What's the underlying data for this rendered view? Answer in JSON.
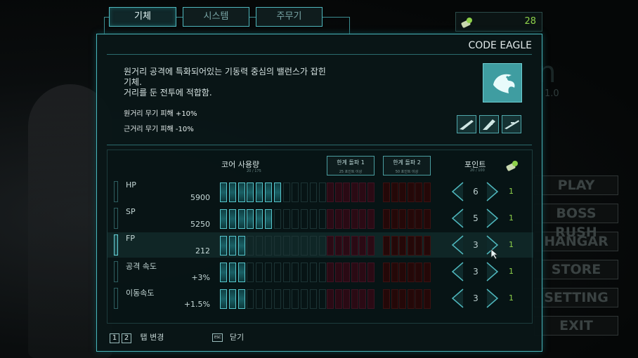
{
  "tabs": [
    {
      "label": "기체",
      "active": true
    },
    {
      "label": "시스템",
      "active": false
    },
    {
      "label": "주무기",
      "active": false
    }
  ],
  "credits": {
    "value": "28",
    "icon": "credit-chip-icon",
    "color": "#8ed14a"
  },
  "background": {
    "menu": [
      "PLAY",
      "BOSS RUSH",
      "HANGAR",
      "STORE",
      "SETTING",
      "EXIT"
    ],
    "version": "1.0"
  },
  "mech": {
    "name": "CODE EAGLE",
    "description_lines": [
      "원거리 공격에 특화되어있는 기동력 중심의 밸런스가  잡힌",
      "기체.",
      "거리를 둔 전투에 적합함."
    ],
    "modifiers": [
      "원거리 무기 피해 +10%",
      "근거리 무기 피해 -10%"
    ],
    "emblem_icon": "eagle-emblem-icon",
    "weapons": [
      "rifle-icon",
      "launcher-icon",
      "sniper-icon"
    ]
  },
  "stats_header": {
    "core_usage_label": "코어 사용량",
    "core_usage_value": "20 / 175",
    "limit1": {
      "title": "한계 돌파 1",
      "sub": "25 포인트 이상"
    },
    "limit2": {
      "title": "한계 돌파 2",
      "sub": "50 포인트 이상"
    },
    "points_label": "포인트",
    "points_value": "20 / 100"
  },
  "stats": [
    {
      "name": "HP",
      "value": "5900",
      "bars_on": 7,
      "points": "6",
      "cost": "1",
      "selected": false
    },
    {
      "name": "SP",
      "value": "5250",
      "bars_on": 6,
      "points": "5",
      "cost": "1",
      "selected": false
    },
    {
      "name": "FP",
      "value": "212",
      "bars_on": 3,
      "points": "3",
      "cost": "1",
      "selected": true
    },
    {
      "name": "공격 속도",
      "value": "+3%",
      "bars_on": 3,
      "points": "3",
      "cost": "1",
      "selected": false
    },
    {
      "name": "이동속도",
      "value": "+1.5%",
      "bars_on": 3,
      "points": "3",
      "cost": "1",
      "selected": false
    }
  ],
  "footer": {
    "tab_keys": [
      "1",
      "2"
    ],
    "tab_change_label": "탭 변경",
    "esc_key": "ESC",
    "close_label": "닫기"
  },
  "colors": {
    "accent": "#49b5bb",
    "bar_on": "#1a6065",
    "limit1": "#2a0a14",
    "limit2": "#240808",
    "cost": "#8ed14a"
  }
}
